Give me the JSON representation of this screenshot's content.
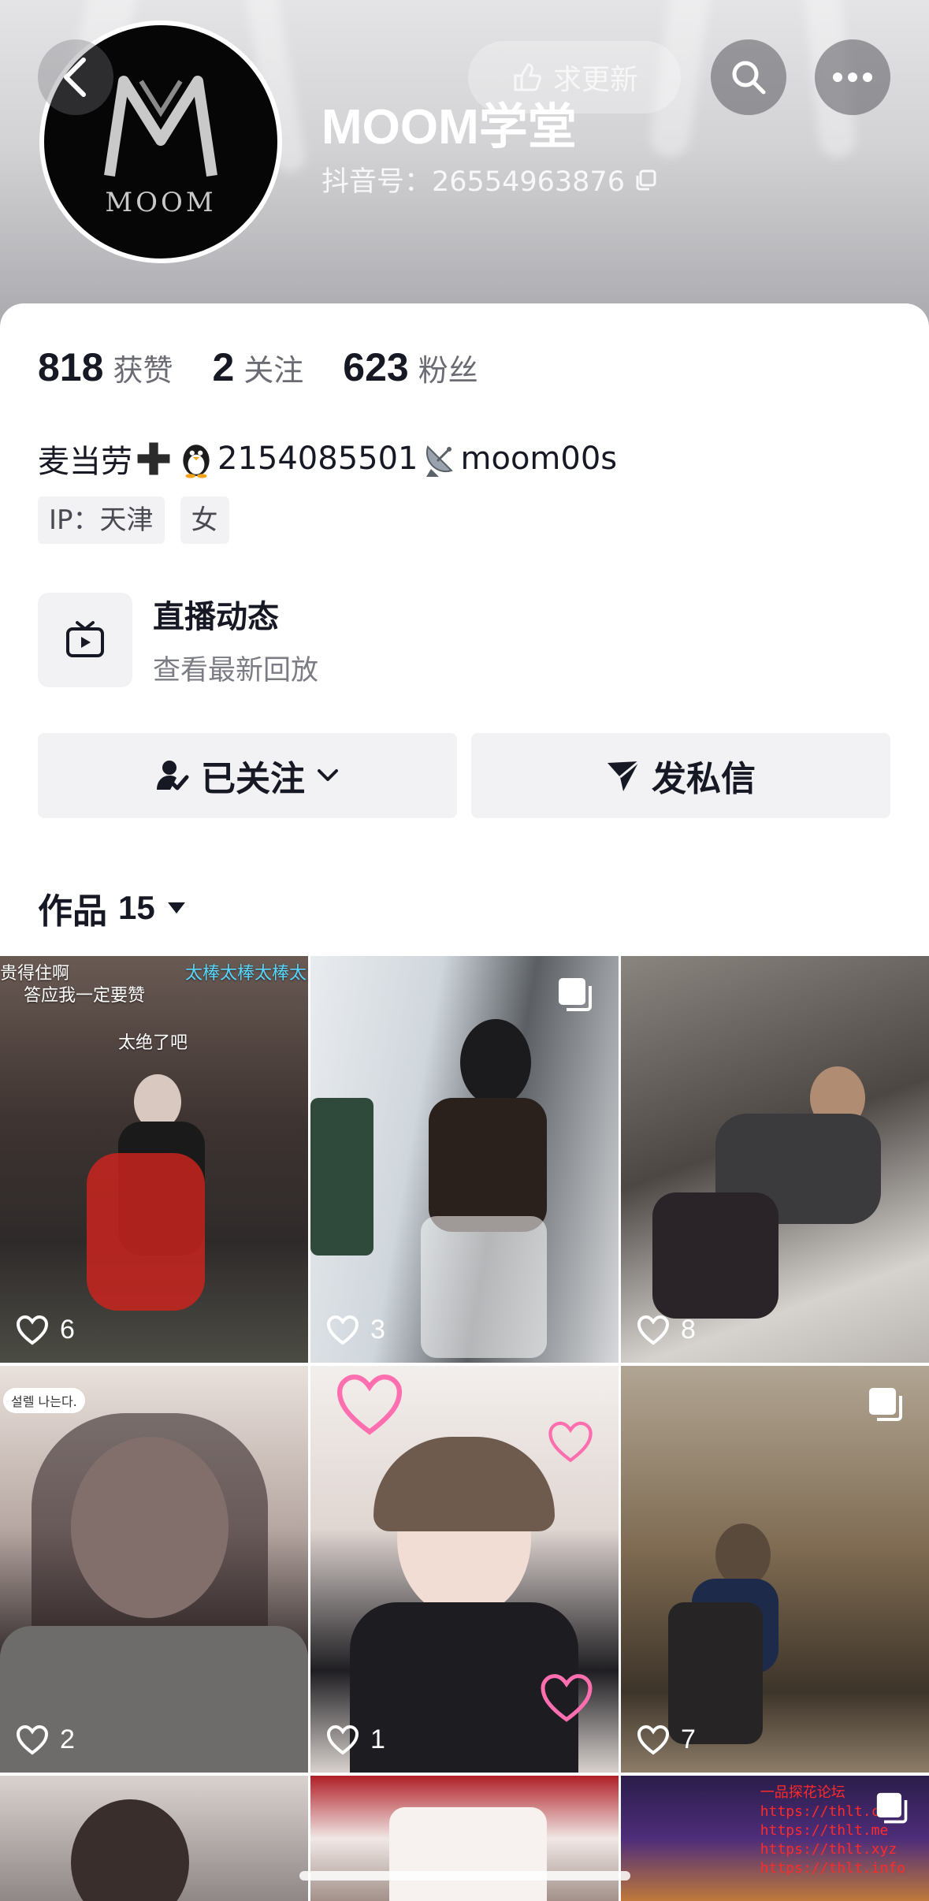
{
  "header": {
    "update_label": "求更新",
    "profile_name": "MOOM学堂",
    "douyin_id_label": "抖音号：",
    "douyin_id": "26554963876",
    "avatar_text": "MOOM"
  },
  "stats": [
    {
      "num": "818",
      "label": "获赞"
    },
    {
      "num": "2",
      "label": "关注"
    },
    {
      "num": "623",
      "label": "粉丝"
    }
  ],
  "bio": {
    "part1": "麦当劳",
    "part2": "2154085501",
    "part3": "moom00s"
  },
  "tags": [
    "IP：天津",
    "女"
  ],
  "live": {
    "title": "直播动态",
    "subtitle": "查看最新回放"
  },
  "actions": {
    "follow_label": "已关注",
    "message_label": "发私信"
  },
  "works": {
    "label": "作品",
    "count": "15"
  },
  "tiles": [
    {
      "likes": "6",
      "overlay_top_left": "贵得住啊",
      "overlay_top_right": "太棒太棒太棒太",
      "overlay_line2": "答应我一定要赞",
      "overlay_center": "太绝了吧"
    },
    {
      "likes": "3"
    },
    {
      "likes": "8"
    },
    {
      "likes": "2",
      "overlay_bubble": "설렐 나는다."
    },
    {
      "likes": "1"
    },
    {
      "likes": "7"
    },
    {
      "watermark": [
        "一品探花论坛",
        "https://thlt.cc",
        "https://thlt.me",
        "https://thlt.xyz",
        "https://thlt.info"
      ]
    }
  ],
  "colors": {
    "text_primary": "#161823",
    "text_secondary": "#6b6c73",
    "button_bg": "#f2f2f4"
  }
}
